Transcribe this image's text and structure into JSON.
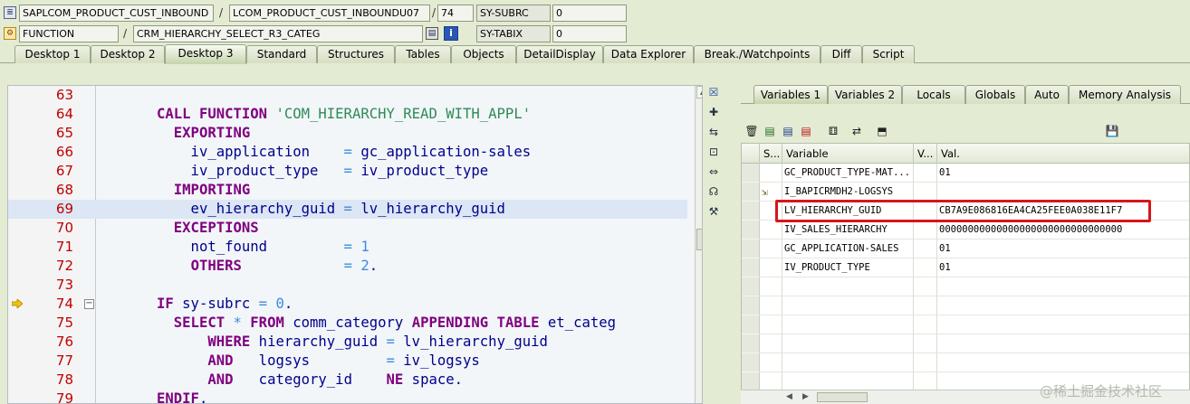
{
  "header": {
    "row1": {
      "program": "SAPLCOM_PRODUCT_CUST_INBOUND",
      "separator1": "/",
      "include": "LCOM_PRODUCT_CUST_INBOUNDU07",
      "separator2": "/",
      "line": "74",
      "var_name": "SY-SUBRC",
      "var_value": "0"
    },
    "row2": {
      "type": "FUNCTION",
      "separator1": "/",
      "event": "CRM_HIERARCHY_SELECT_R3_CATEG",
      "var_name": "SY-TABIX",
      "var_value": "0"
    }
  },
  "desktop_tabs": [
    "Desktop 1",
    "Desktop 2",
    "Desktop 3",
    "Standard",
    "Structures",
    "Tables",
    "Objects",
    "DetailDisplay",
    "Data Explorer",
    "Break./Watchpoints",
    "Diff",
    "Script"
  ],
  "desktop_active": "Desktop 3",
  "code": {
    "lines": [
      {
        "n": "63",
        "t": ""
      },
      {
        "n": "64",
        "t": "CALL FUNCTION 'COM_HIERARCHY_READ_WITH_APPL'"
      },
      {
        "n": "65",
        "t": "  EXPORTING"
      },
      {
        "n": "66",
        "t": "    iv_application    = gc_application-sales"
      },
      {
        "n": "67",
        "t": "    iv_product_type   = iv_product_type"
      },
      {
        "n": "68",
        "t": "  IMPORTING"
      },
      {
        "n": "69",
        "t": "    ev_hierarchy_guid = lv_hierarchy_guid"
      },
      {
        "n": "70",
        "t": "  EXCEPTIONS"
      },
      {
        "n": "71",
        "t": "    not_found         = 1"
      },
      {
        "n": "72",
        "t": "    OTHERS            = 2."
      },
      {
        "n": "73",
        "t": ""
      },
      {
        "n": "74",
        "t": "IF sy-subrc = 0."
      },
      {
        "n": "75",
        "t": "  SELECT * FROM comm_category APPENDING TABLE et_categ"
      },
      {
        "n": "76",
        "t": "      WHERE hierarchy_guid = lv_hierarchy_guid"
      },
      {
        "n": "77",
        "t": "      AND   logsys         = iv_logsys"
      },
      {
        "n": "78",
        "t": "      AND   category_id    NE space."
      },
      {
        "n": "79",
        "t": "ENDIF."
      }
    ]
  },
  "tool_icons": [
    "close-icon",
    "new-tool-icon",
    "swap-tool-icon",
    "maximize-tool-icon",
    "expand-width-icon",
    "headset-icon",
    "service-icon"
  ],
  "right_tabs": [
    "Variables 1",
    "Variables 2",
    "Locals",
    "Globals",
    "Auto",
    "Memory Analysis"
  ],
  "right_active": "Variables 1",
  "right_toolbar": [
    "delete-icon",
    "detail-view-icon",
    "change-view-icon",
    "delete-all-icon",
    "hierarchy-icon",
    "transfer-icon",
    "load-icon",
    "save-icon"
  ],
  "grid": {
    "columns": [
      "S...",
      "Variable",
      "V...",
      "Val."
    ],
    "rows": [
      {
        "variable": "GC_PRODUCT_TYPE-MAT...",
        "value": "01",
        "icon": ""
      },
      {
        "variable": "I_BAPICRMDH2-LOGSYS",
        "value": "",
        "icon": "import-icon"
      },
      {
        "variable": "LV_HIERARCHY_GUID",
        "value": "CB7A9E086816EA4CA25FEE0A038E11F7",
        "icon": ""
      },
      {
        "variable": "IV_SALES_HIERARCHY",
        "value": "00000000000000000000000000000000",
        "icon": ""
      },
      {
        "variable": "GC_APPLICATION-SALES",
        "value": "01",
        "icon": ""
      },
      {
        "variable": "IV_PRODUCT_TYPE",
        "value": "01",
        "icon": ""
      },
      {
        "variable": "",
        "value": "",
        "icon": ""
      },
      {
        "variable": "",
        "value": "",
        "icon": ""
      },
      {
        "variable": "",
        "value": "",
        "icon": ""
      },
      {
        "variable": "",
        "value": "",
        "icon": ""
      },
      {
        "variable": "",
        "value": "",
        "icon": ""
      },
      {
        "variable": "",
        "value": "",
        "icon": ""
      }
    ]
  },
  "watermark": "@稀土掘金技术社区"
}
